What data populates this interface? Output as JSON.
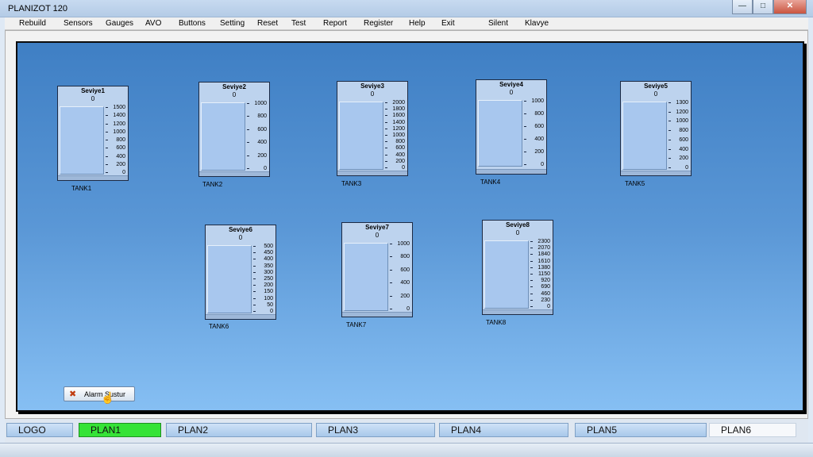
{
  "window": {
    "title": "PLANIZOT  120",
    "minimize": "—",
    "maximize": "□",
    "close": "✕"
  },
  "menu": [
    "Rebuild",
    "Sensors",
    "Gauges",
    "AVO",
    "Buttons",
    "Setting",
    "Reset",
    "Test",
    "Report",
    "Register",
    "Help",
    "Exit",
    "Silent",
    "Klavye"
  ],
  "gauges": [
    {
      "title": "Seviye1",
      "value": "0",
      "tank": "TANK1",
      "ticks": [
        "1500",
        "1400",
        "1200",
        "1000",
        "800",
        "600",
        "400",
        "200",
        "0"
      ]
    },
    {
      "title": "Seviye2",
      "value": "0",
      "tank": "TANK2",
      "ticks": [
        "1000",
        "800",
        "600",
        "400",
        "200",
        "0"
      ]
    },
    {
      "title": "Seviye3",
      "value": "0",
      "tank": "TANK3",
      "ticks": [
        "2000",
        "1800",
        "1600",
        "1400",
        "1200",
        "1000",
        "800",
        "600",
        "400",
        "200",
        "0"
      ]
    },
    {
      "title": "Seviye4",
      "value": "0",
      "tank": "TANK4",
      "ticks": [
        "1000",
        "800",
        "600",
        "400",
        "200",
        "0"
      ]
    },
    {
      "title": "Seviye5",
      "value": "0",
      "tank": "TANK5",
      "ticks": [
        "1300",
        "1200",
        "1000",
        "800",
        "600",
        "400",
        "200",
        "0"
      ]
    },
    {
      "title": "Seviye6",
      "value": "0",
      "tank": "TANK6",
      "ticks": [
        "500",
        "450",
        "400",
        "350",
        "300",
        "250",
        "200",
        "150",
        "100",
        "50",
        "0"
      ]
    },
    {
      "title": "Seviye7",
      "value": "0",
      "tank": "TANK7",
      "ticks": [
        "1000",
        "800",
        "600",
        "400",
        "200",
        "0"
      ]
    },
    {
      "title": "Seviye8",
      "value": "0",
      "tank": "TANK8",
      "ticks": [
        "2300",
        "2070",
        "1840",
        "1610",
        "1380",
        "1150",
        "920",
        "690",
        "460",
        "230",
        "0"
      ]
    }
  ],
  "alarm_button": {
    "label": "Alarm Sustur",
    "icon": "alarm-mute-icon"
  },
  "plans": [
    "LOGO",
    "PLAN1",
    "PLAN2",
    "PLAN3",
    "PLAN4",
    "PLAN5",
    "PLAN6"
  ],
  "active_plan": "PLAN1",
  "colors": {
    "canvas_top": "#3f7fc4",
    "canvas_bottom": "#86bff3",
    "active_tab": "#35e337"
  }
}
